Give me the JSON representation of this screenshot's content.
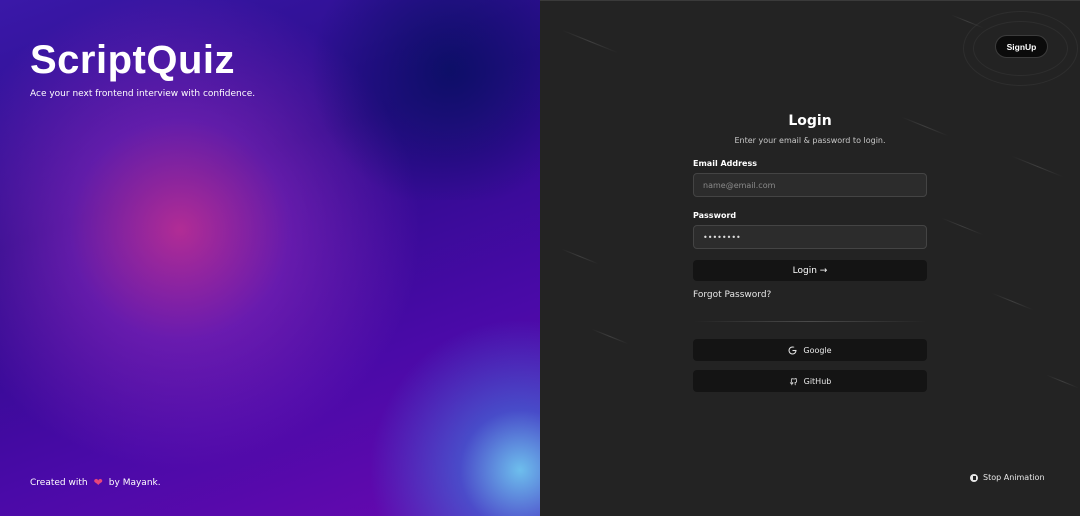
{
  "brand": {
    "name": "ScriptQuiz",
    "tagline": "Ace your next frontend interview with confidence.",
    "credit_prefix": "Created with",
    "credit_suffix": "by Mayank."
  },
  "header": {
    "signup_label": "SignUp"
  },
  "login_form": {
    "title": "Login",
    "subtitle": "Enter your email & password to login.",
    "email_label": "Email Address",
    "email_placeholder": "name@email.com",
    "email_value": "",
    "password_label": "Password",
    "password_value": "••••••••",
    "submit_label": "Login →",
    "forgot_label": "Forgot Password?"
  },
  "oauth": {
    "google_label": "Google",
    "github_label": "GitHub"
  },
  "footer": {
    "stop_animation_label": "Stop Animation"
  },
  "icons": {
    "heart": "heart-icon",
    "google": "google-icon",
    "github": "github-icon",
    "stop": "pause-icon"
  },
  "colors": {
    "left_panel_accent": "#3a18a8",
    "right_panel_bg": "#232323",
    "button_bg": "#141414",
    "heart": "#e8457a"
  }
}
